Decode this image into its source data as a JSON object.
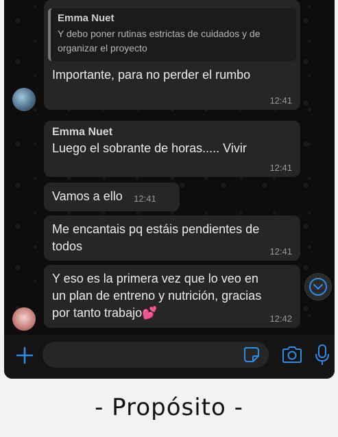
{
  "messages": {
    "m1": {
      "quote_sender": "Emma Nuet",
      "quote_text": "Y debo poner rutinas estrictas de cuidados y de organizar el proyecto",
      "text": "Importante, para no perder el rumbo",
      "time": "12:41"
    },
    "m2": {
      "sender": "Emma Nuet",
      "text": "Luego el sobrante de horas..... Vivir",
      "time": "12:41"
    },
    "m3": {
      "text": "Vamos a ello",
      "time": "12:41"
    },
    "m4": {
      "text": "Me encantais pq estáis pendientes de todos",
      "time": "12:41"
    },
    "m5": {
      "text": "Y eso es la primera vez que lo veo en un plan de entreno y nutrición, gracias por tanto trabajo💕",
      "time": "12:42"
    }
  },
  "input": {
    "value": ""
  },
  "icons": {
    "plus": "plus-icon",
    "sticker": "sticker-icon",
    "camera": "camera-icon",
    "mic": "microphone-icon",
    "scroll": "chevron-down-icon"
  },
  "colors": {
    "accent": "#2f8de4",
    "bubble": "#262626",
    "background": "#0d0d0d"
  },
  "caption": "- Propósito -"
}
